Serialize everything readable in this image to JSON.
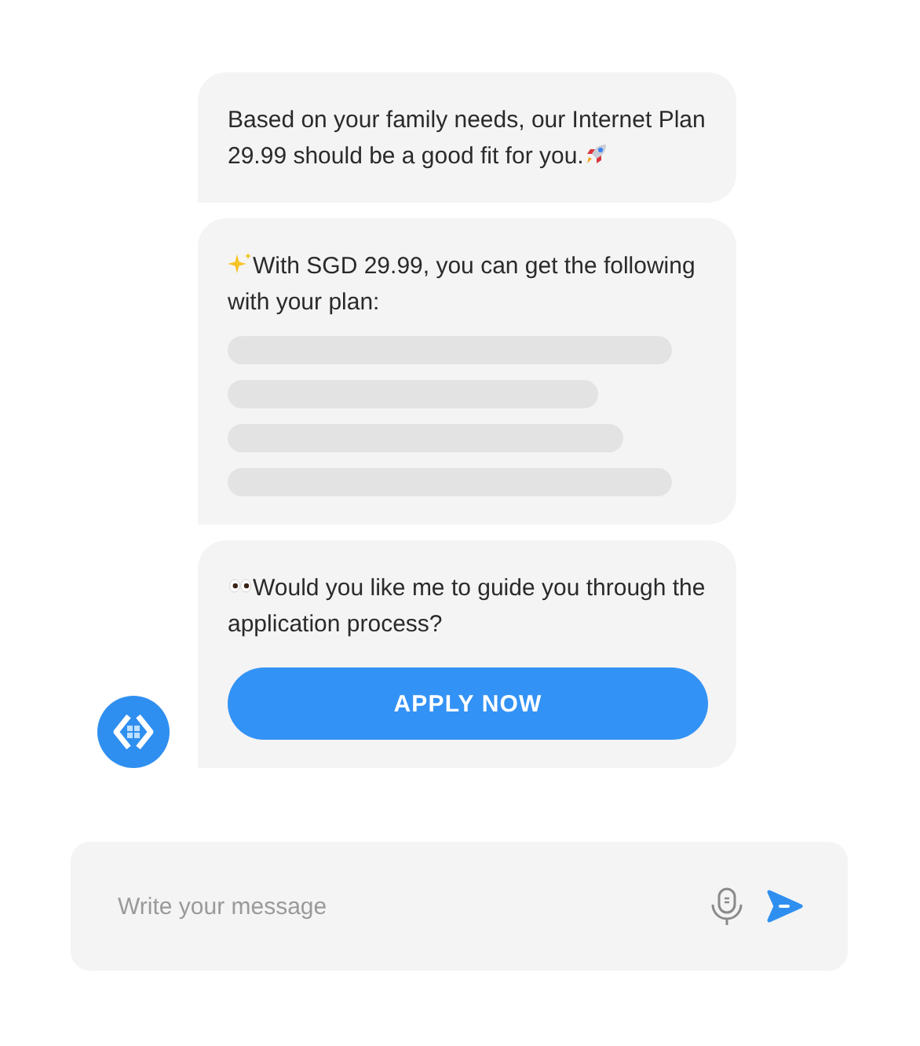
{
  "messages": [
    {
      "kind": "text",
      "text": "Based on your family needs, our Internet Plan 29.99 should be a good fit for you.",
      "trailing_icon": {
        "kind": "rocket"
      }
    },
    {
      "kind": "loading",
      "leading_icon": {
        "kind": "sparkles"
      },
      "text": "With SGD 29.99, you can get the following with your plan:"
    },
    {
      "kind": "action",
      "leading_icon": {
        "kind": "eyes"
      },
      "text": "Would you like me to guide you through the application process?",
      "button": "APPLY NOW"
    }
  ],
  "composer": {
    "placeholder": "Write your message"
  }
}
